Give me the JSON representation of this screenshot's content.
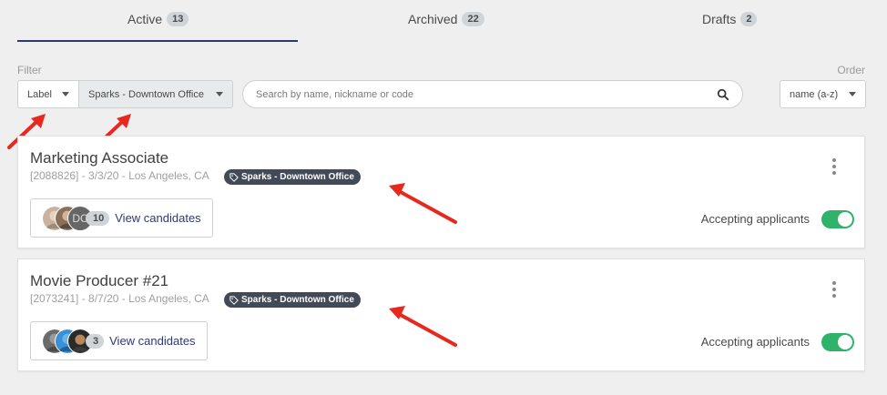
{
  "tabs": [
    {
      "label": "Active",
      "count": "13"
    },
    {
      "label": "Archived",
      "count": "22"
    },
    {
      "label": "Drafts",
      "count": "2"
    }
  ],
  "filter": {
    "title": "Filter",
    "label_select": "Label",
    "office_select": "Sparks - Downtown Office"
  },
  "search": {
    "placeholder": "Search by name, nickname or code",
    "icon": "search-icon"
  },
  "order": {
    "title": "Order",
    "value": "name (a-z)"
  },
  "jobs": [
    {
      "title": "Marketing Associate",
      "meta": "[2088826] - 3/3/20 - Los Angeles, CA",
      "tag": "Sparks - Downtown Office",
      "candidates_count": "10",
      "view_label": "View candidates",
      "accepting_label": "Accepting applicants",
      "accepting": true,
      "avatar_initials": "DC"
    },
    {
      "title": "Movie Producer #21",
      "meta": "[2073241] - 8/7/20 - Los Angeles, CA",
      "tag": "Sparks - Downtown Office",
      "candidates_count": "3",
      "view_label": "View candidates",
      "accepting_label": "Accepting applicants",
      "accepting": true,
      "avatar_initials": ""
    }
  ],
  "colors": {
    "accent": "#2b3a73",
    "toggle_on": "#2fb36a",
    "tag_bg": "#434a57",
    "arrow": "#e8281e"
  }
}
